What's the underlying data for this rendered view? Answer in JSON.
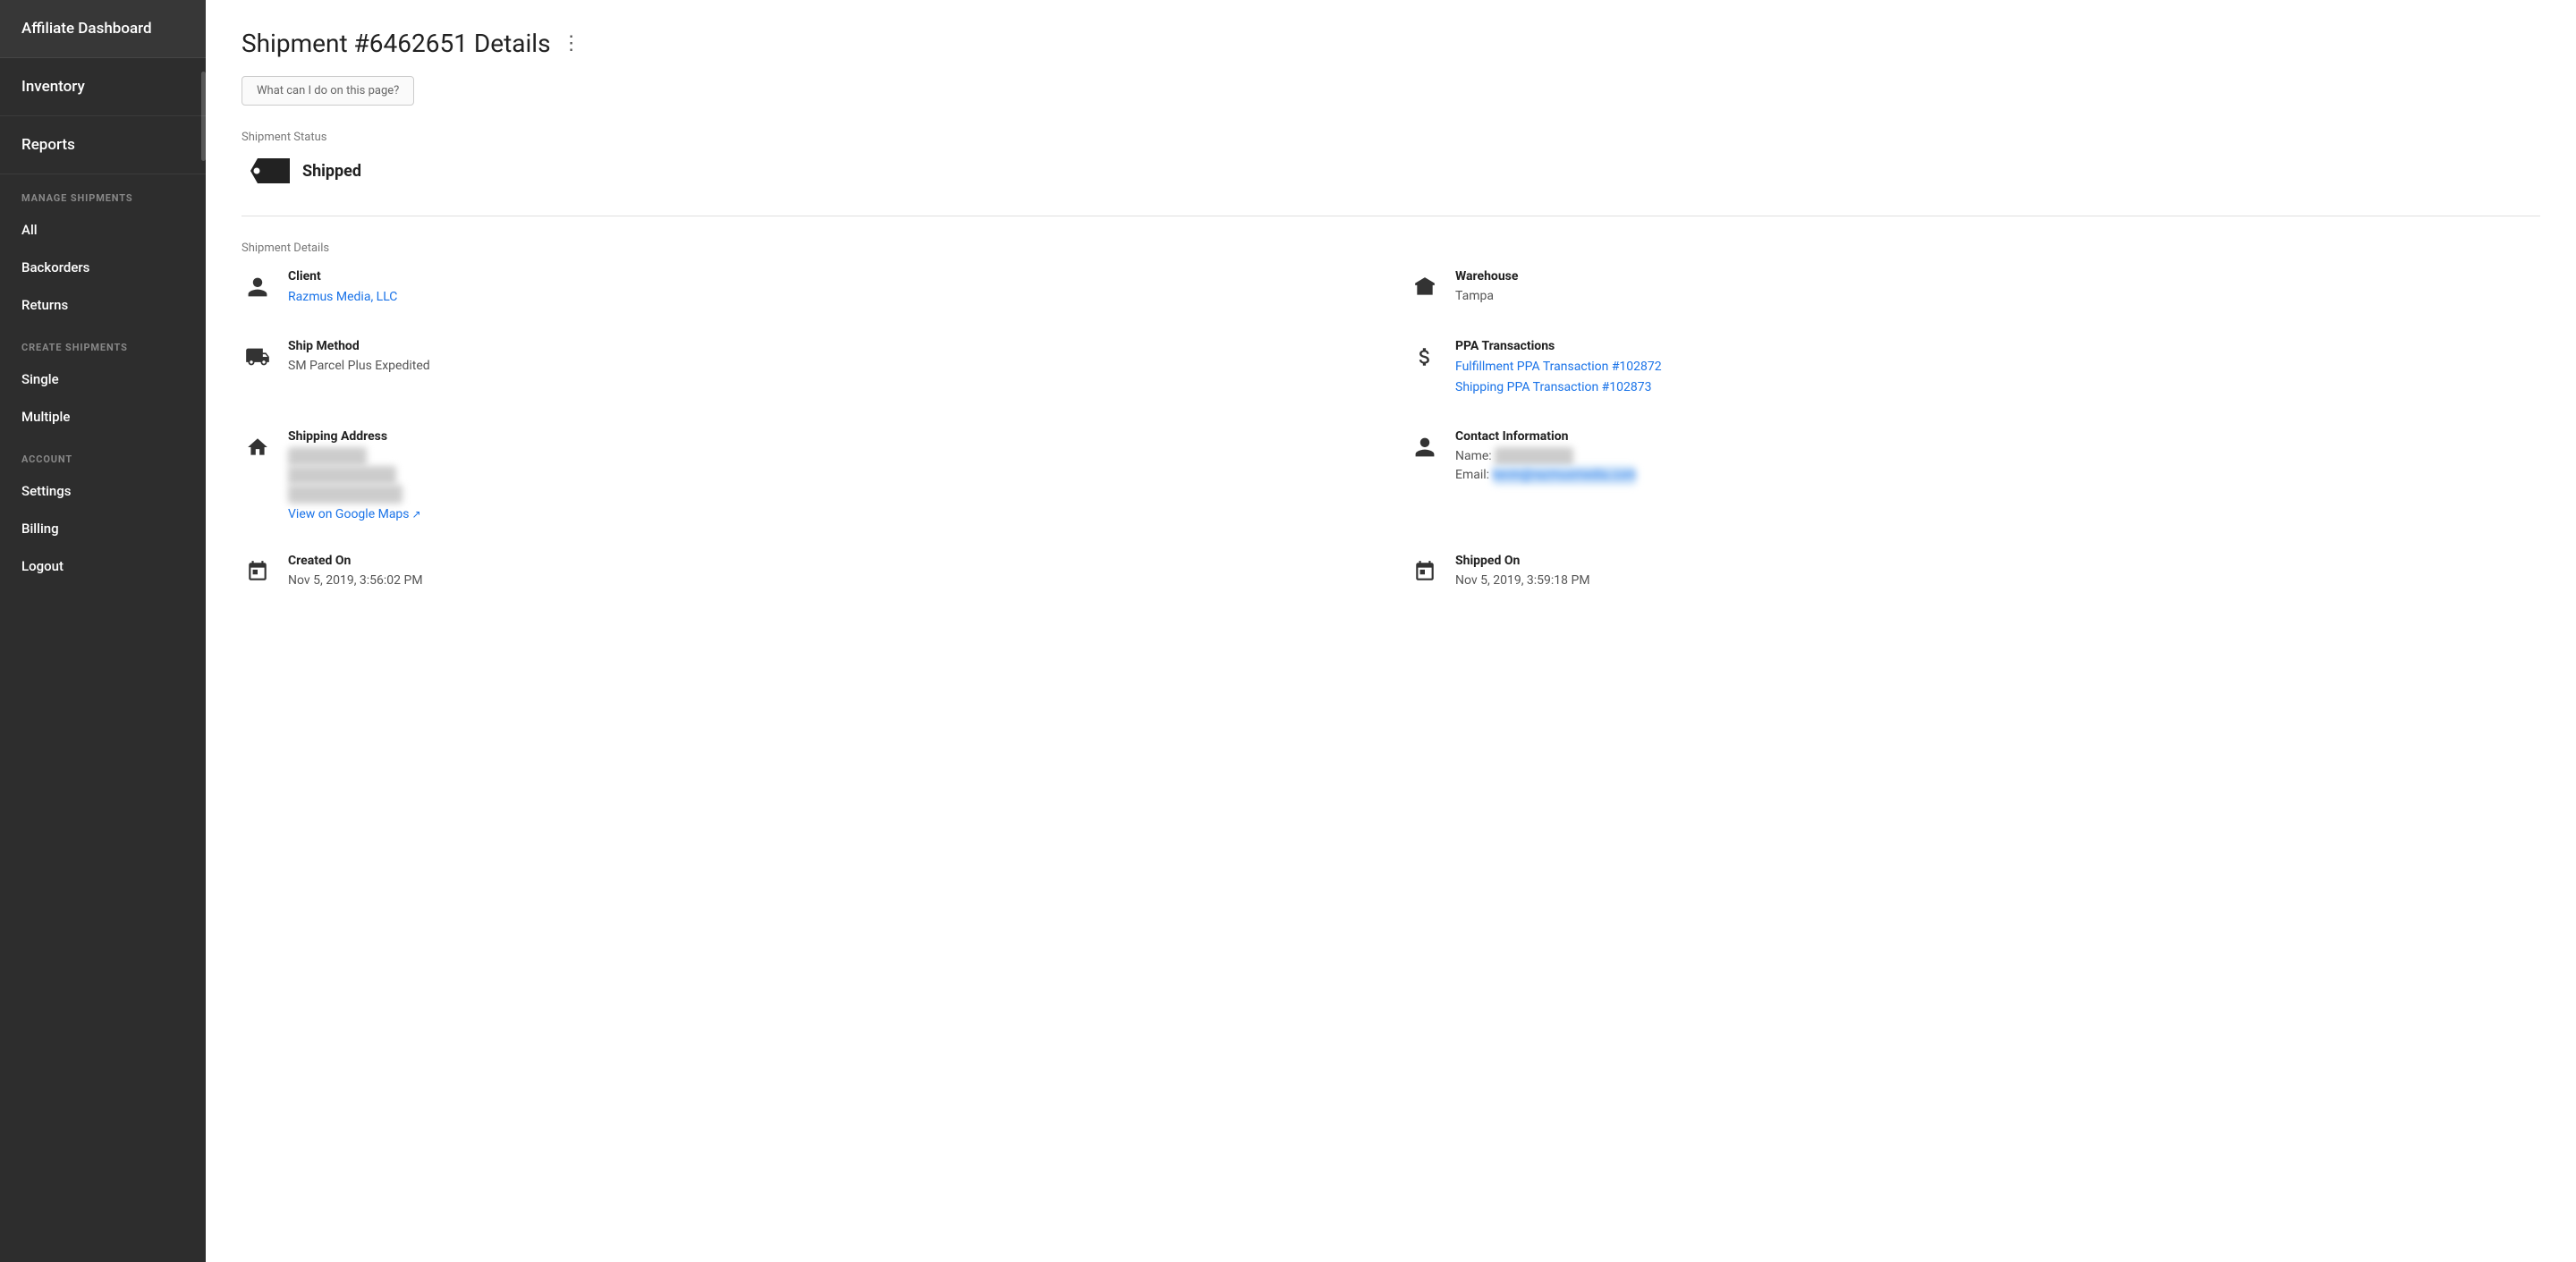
{
  "sidebar": {
    "top_items": [
      {
        "label": "Affiliate Dashboard",
        "name": "affiliate-dashboard"
      },
      {
        "label": "Inventory",
        "name": "inventory"
      },
      {
        "label": "Reports",
        "name": "reports"
      }
    ],
    "sections": [
      {
        "label": "MANAGE SHIPMENTS",
        "items": [
          {
            "label": "All",
            "name": "manage-all"
          },
          {
            "label": "Backorders",
            "name": "manage-backorders"
          },
          {
            "label": "Returns",
            "name": "manage-returns"
          }
        ]
      },
      {
        "label": "CREATE SHIPMENTS",
        "items": [
          {
            "label": "Single",
            "name": "create-single"
          },
          {
            "label": "Multiple",
            "name": "create-multiple"
          }
        ]
      },
      {
        "label": "ACCOUNT",
        "items": [
          {
            "label": "Settings",
            "name": "account-settings"
          },
          {
            "label": "Billing",
            "name": "account-billing"
          },
          {
            "label": "Logout",
            "name": "account-logout"
          }
        ]
      }
    ]
  },
  "page": {
    "title": "Shipment #6462651 Details",
    "more_icon": "⋮",
    "help_button": "What can I do on this page?",
    "status_section_label": "Shipment Status",
    "status_value": "Shipped",
    "details_section_label": "Shipment Details",
    "details": [
      {
        "id": "client",
        "icon": "person",
        "title": "Client",
        "value": "",
        "link": "Razmus Media, LLC",
        "side": "left"
      },
      {
        "id": "warehouse",
        "icon": "building",
        "title": "Warehouse",
        "value": "Tampa",
        "side": "right"
      },
      {
        "id": "ship-method",
        "icon": "truck",
        "title": "Ship Method",
        "value": "SM Parcel Plus Expedited",
        "side": "left"
      },
      {
        "id": "ppa-transactions",
        "icon": "dollar",
        "title": "PPA Transactions",
        "links": [
          "Fulfillment PPA Transaction #102872",
          "Shipping PPA Transaction #102873"
        ],
        "side": "right"
      },
      {
        "id": "shipping-address",
        "icon": "home",
        "title": "Shipping Address",
        "blurred": [
          "Kevin Razmus",
          "10014 Glenalder Pl.",
          "Tampa, FL 33626 US"
        ],
        "map_link": "View on Google Maps",
        "side": "left"
      },
      {
        "id": "contact-info",
        "icon": "person",
        "title": "Contact Information",
        "contact_name_label": "Name:",
        "contact_name_blurred": "Kevin Razmus",
        "contact_email_label": "Email:",
        "contact_email_blurred": "kevin@razmusmedia.com",
        "side": "right"
      },
      {
        "id": "created-on",
        "icon": "calendar",
        "title": "Created On",
        "value": "Nov 5, 2019, 3:56:02 PM",
        "side": "left"
      },
      {
        "id": "shipped-on",
        "icon": "calendar",
        "title": "Shipped On",
        "value": "Nov 5, 2019, 3:59:18 PM",
        "side": "right"
      }
    ]
  }
}
